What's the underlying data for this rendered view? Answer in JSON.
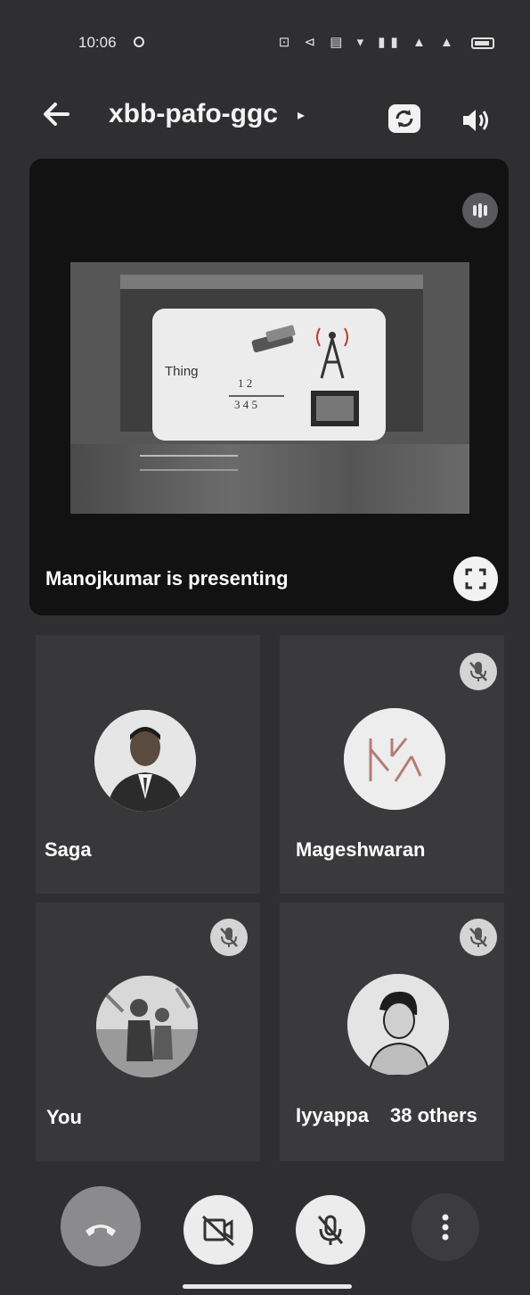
{
  "status_bar": {
    "time": "10:06",
    "icons_text": "⊡ ⊲ ▤ ▾ ▮▮ ▲ ▲"
  },
  "header": {
    "meeting_code": "xbb-pafo-ggc",
    "chevron": "▸"
  },
  "presentation": {
    "presenter_label": "Manojkumar is presenting",
    "slide_text": "Thing"
  },
  "participants": [
    {
      "name": "Saga",
      "muted": false
    },
    {
      "name": "Mageshwaran",
      "muted": true
    },
    {
      "name": "You",
      "muted": true
    },
    {
      "name": "Iyyappa",
      "muted": true,
      "others_label": "38 others"
    }
  ],
  "icons": {
    "back": "back-arrow-icon",
    "switch_camera": "switch-camera-icon",
    "speaker": "speaker-icon",
    "audio": "audio-level-icon",
    "fullscreen": "fullscreen-icon",
    "mic_off": "mic-off-icon",
    "end_call": "end-call-icon",
    "camera_off": "camera-off-icon",
    "more": "more-vertical-icon"
  },
  "colors": {
    "background": "#2f2f31",
    "tile": "#38383a",
    "control_light": "#ececec",
    "end_call": "#8b8b8d"
  }
}
